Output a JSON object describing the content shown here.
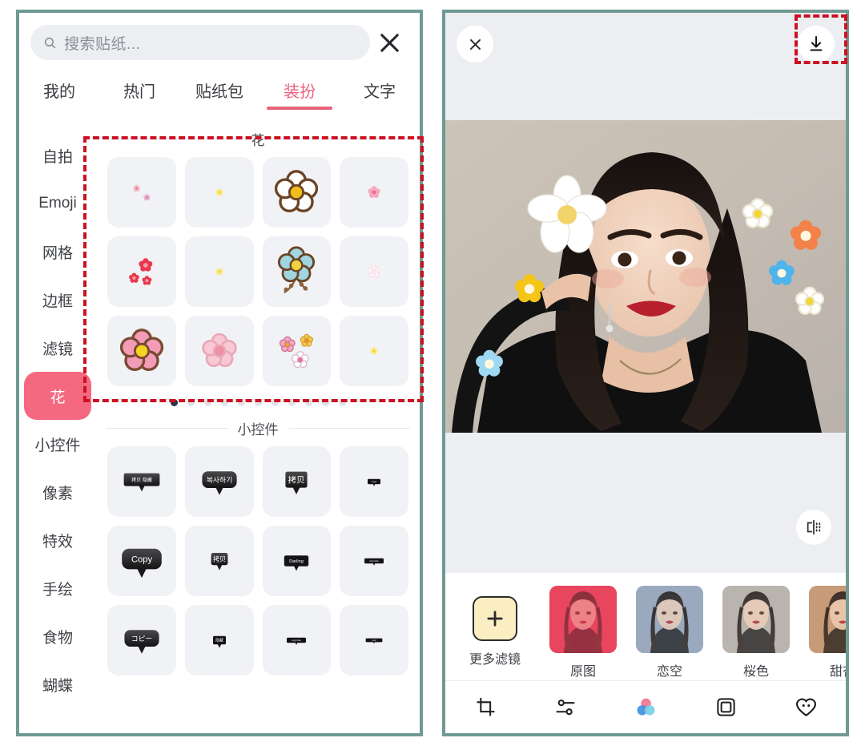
{
  "theme": {
    "frame_color": "#6f9a93",
    "accent_pink": "#e8637b",
    "selected_pill": "#f4697f",
    "annotation_red": "#cc1122",
    "panel_gray": "#eceef1",
    "cell_gray": "#f1f2f5"
  },
  "left_panel": {
    "search": {
      "placeholder": "搜索贴纸...",
      "value": "",
      "icon": "search-icon"
    },
    "close_icon": "close-icon",
    "tabs": [
      {
        "label": "我的",
        "active": false
      },
      {
        "label": "热门",
        "active": false
      },
      {
        "label": "贴纸包",
        "active": false
      },
      {
        "label": "装扮",
        "active": true
      },
      {
        "label": "文字",
        "active": false
      }
    ],
    "sidebar": [
      {
        "label": "自拍",
        "selected": false
      },
      {
        "label": "Emoji",
        "selected": false
      },
      {
        "label": "网格",
        "selected": false
      },
      {
        "label": "边框",
        "selected": false
      },
      {
        "label": "滤镜",
        "selected": false
      },
      {
        "label": "花",
        "selected": true
      },
      {
        "label": "小控件",
        "selected": false
      },
      {
        "label": "像素",
        "selected": false
      },
      {
        "label": "特效",
        "selected": false
      },
      {
        "label": "手绘",
        "selected": false
      },
      {
        "label": "食物",
        "selected": false
      },
      {
        "label": "蝴蝶",
        "selected": false
      }
    ],
    "sections": [
      {
        "title": "花",
        "highlighted": true,
        "stickers": [
          {
            "name": "tiny-pink-dots-flower",
            "kind": "dots",
            "size": "xs"
          },
          {
            "name": "tiny-pale-yellow-flower",
            "kind": "dot",
            "size": "xs"
          },
          {
            "name": "white-daisy-yellow-center",
            "kind": "daisy",
            "size": "lg"
          },
          {
            "name": "small-pink-blossom",
            "kind": "blossom",
            "size": "xs"
          },
          {
            "name": "red-cherry-blossoms",
            "kind": "cluster",
            "size": "sm"
          },
          {
            "name": "tiny-yellow-dot-flower",
            "kind": "dot",
            "size": "xs"
          },
          {
            "name": "blue-flower-with-stem",
            "kind": "stem",
            "size": "lg"
          },
          {
            "name": "faint-outline-blossom",
            "kind": "blossom",
            "size": "xs"
          },
          {
            "name": "pink-flower-yellow-center",
            "kind": "daisy",
            "size": "lg"
          },
          {
            "name": "pale-pink-blossom",
            "kind": "blossom",
            "size": "md"
          },
          {
            "name": "three-small-flowers-cluster",
            "kind": "cluster",
            "size": "md"
          },
          {
            "name": "tiny-yellow-speck",
            "kind": "dot",
            "size": "xs"
          }
        ],
        "pagination": {
          "total": 11,
          "active_index": 0
        }
      },
      {
        "title": "小控件",
        "highlighted": false,
        "stickers": [
          {
            "name": "bubble-copy-hide-cn",
            "text": "拷贝  隐藏",
            "style": "wide-flat"
          },
          {
            "name": "bubble-copy-kr",
            "text": "복사하기",
            "style": "rounded-large"
          },
          {
            "name": "bubble-copy-cn-bold",
            "text": "拷贝",
            "style": "square-bold"
          },
          {
            "name": "bubble-tiny-1",
            "text": "copy",
            "style": "tiny"
          },
          {
            "name": "bubble-copy-script",
            "text": "Copy",
            "style": "rounded-xl"
          },
          {
            "name": "bubble-copy-cn-small",
            "text": "拷贝",
            "style": "small-bold"
          },
          {
            "name": "bubble-darling",
            "text": "Darling",
            "style": "small"
          },
          {
            "name": "bubble-tiny-2",
            "text": "copy hide",
            "style": "tiny-wide"
          },
          {
            "name": "bubble-copy-jp",
            "text": "コピー",
            "style": "rounded-large"
          },
          {
            "name": "bubble-hide-cn",
            "text": "隐藏",
            "style": "tiny-bold"
          },
          {
            "name": "bubble-tiny-3",
            "text": "copy  hide",
            "style": "tiny-wide"
          },
          {
            "name": "bubble-tiny-4",
            "text": "copy",
            "style": "tiny-bar"
          }
        ]
      }
    ]
  },
  "right_panel": {
    "close_icon": "close-icon",
    "save_icon": "download-icon",
    "compare_icon": "compare-flip-icon",
    "photo": {
      "alt": "woman holding white flower to hair, black jacket, light wall",
      "overlay_stickers": [
        {
          "name": "white-plumeria-flower",
          "x": 23,
          "y": 28,
          "size": 62,
          "color": "#ffffff"
        },
        {
          "name": "white-daisy-sticker",
          "x": 78,
          "y": 30,
          "size": 34,
          "color": "#ffffff"
        },
        {
          "name": "orange-flower-sticker",
          "x": 90,
          "y": 37,
          "size": 36,
          "color": "#f3814a"
        },
        {
          "name": "blue-flower-sticker",
          "x": 84,
          "y": 49,
          "size": 30,
          "color": "#4fb4ec"
        },
        {
          "name": "white-yellow-flower-sticker",
          "x": 91,
          "y": 58,
          "size": 32,
          "color": "#ffffff"
        },
        {
          "name": "yellow-flower-sticker",
          "x": 21,
          "y": 54,
          "size": 34,
          "color": "#f5c518"
        },
        {
          "name": "light-blue-flower-sticker",
          "x": 11,
          "y": 78,
          "size": 32,
          "color": "#9fd8f2"
        }
      ]
    },
    "more_filters": {
      "label": "更多滤镜",
      "icon": "plus-icon"
    },
    "filters": [
      {
        "label": "原图",
        "selected": true,
        "tint": "#e8455f"
      },
      {
        "label": "恋空",
        "selected": false,
        "tint": "#9aa9bd"
      },
      {
        "label": "桜色",
        "selected": false,
        "tint": "#b9b4ae"
      },
      {
        "label": "甜杏",
        "selected": false,
        "tint": "#c79a78"
      }
    ],
    "toolbar": [
      {
        "name": "crop-icon",
        "label": "裁剪",
        "active": false
      },
      {
        "name": "adjust-icon",
        "label": "调节",
        "active": false
      },
      {
        "name": "filter-icon",
        "label": "滤镜",
        "active": true
      },
      {
        "name": "frame-icon",
        "label": "边框",
        "active": false
      },
      {
        "name": "sticker-icon",
        "label": "贴纸",
        "active": false
      }
    ]
  }
}
